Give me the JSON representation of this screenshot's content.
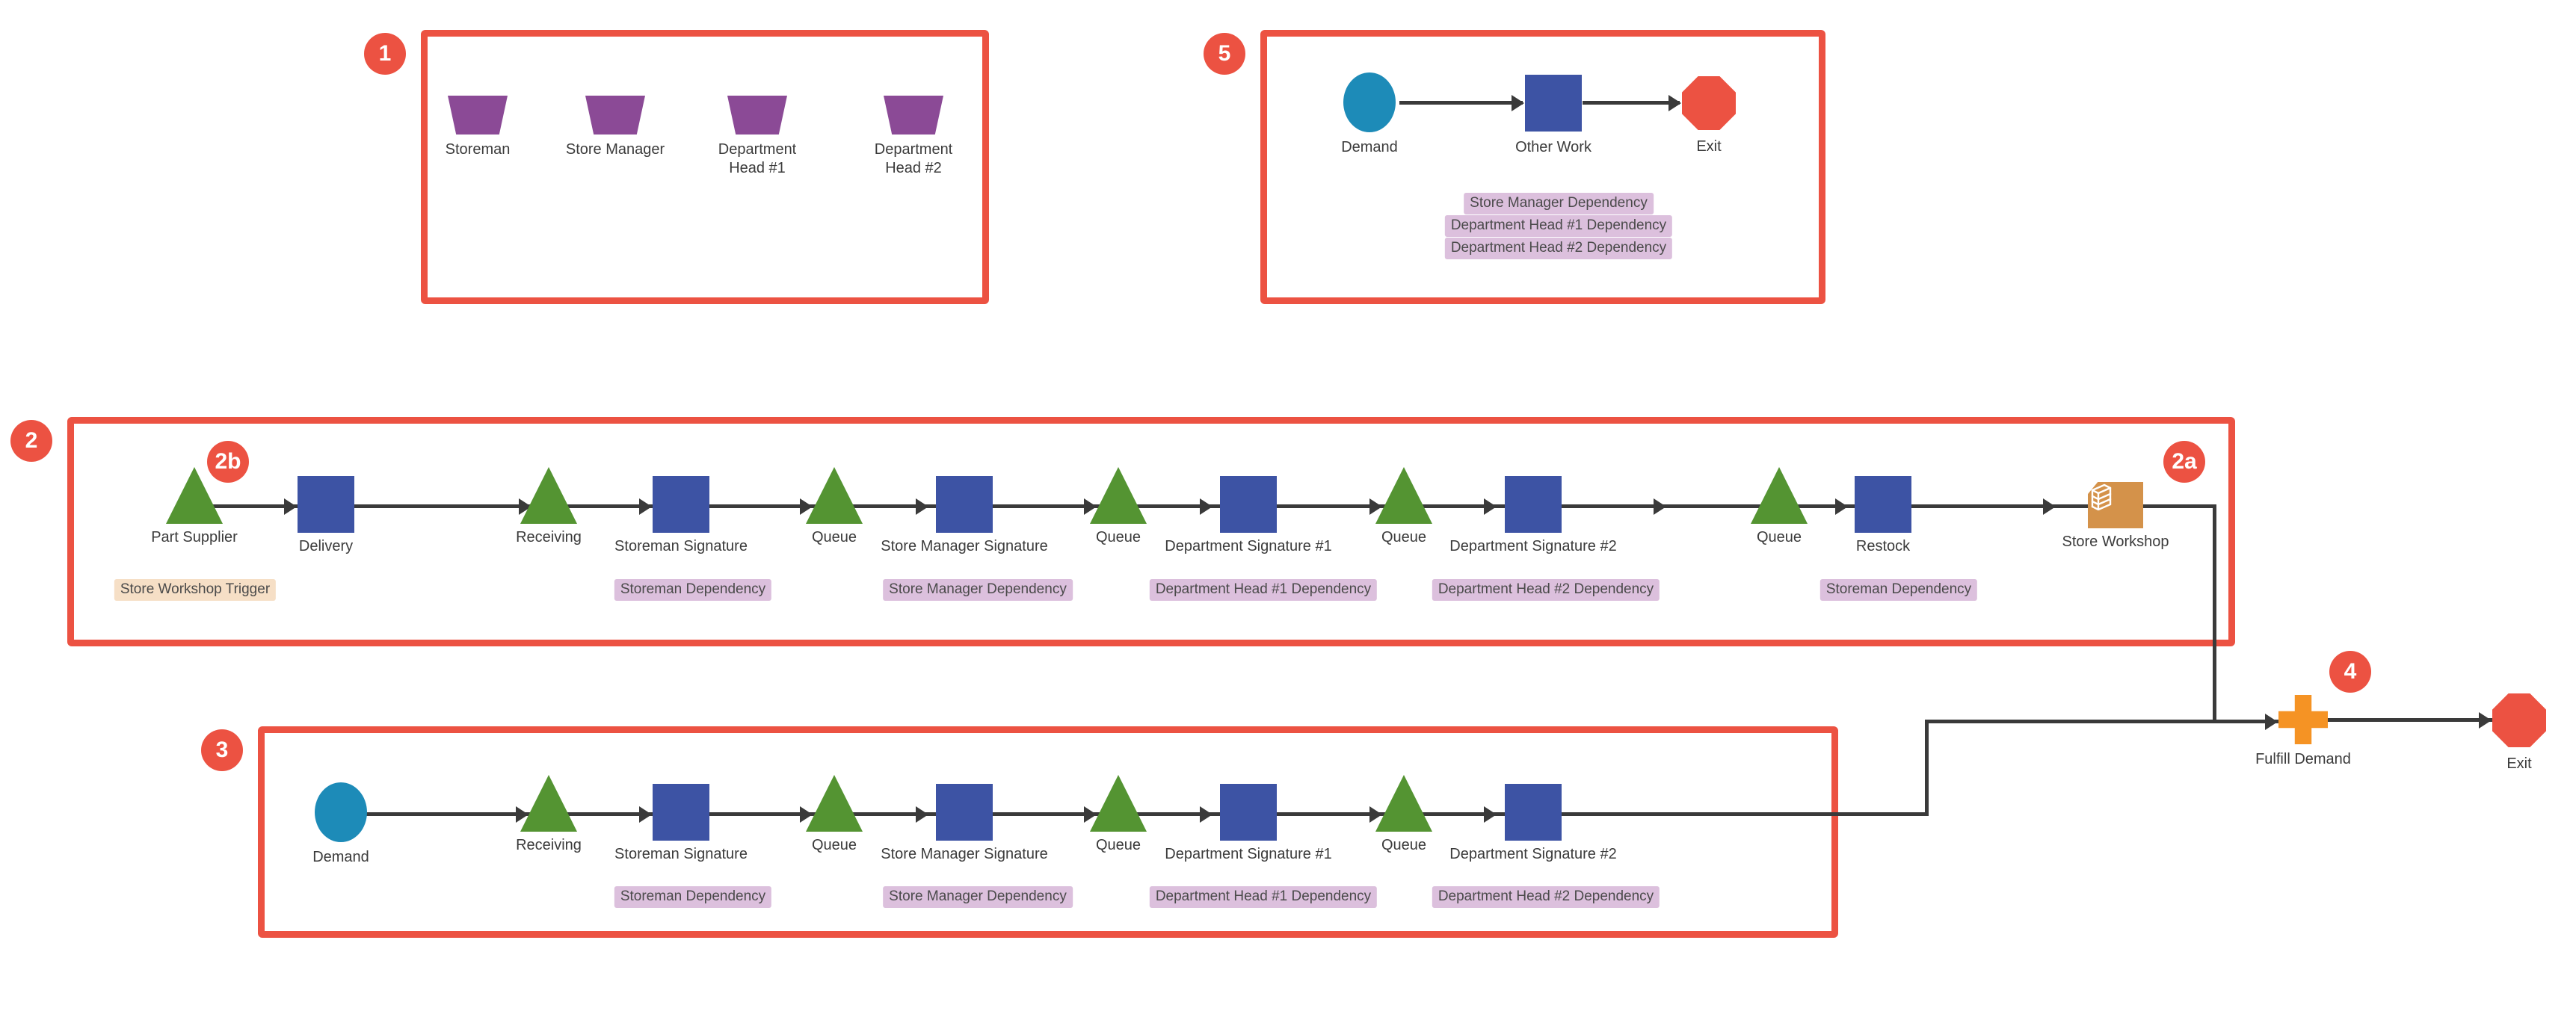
{
  "diagram": {
    "colors": {
      "frame": "#EC5242",
      "badge": "#EC5242",
      "resource": "#8B4A96",
      "source_queue": "#549432",
      "activity": "#3D53A4",
      "demand": "#1D8BB8",
      "exit": "#EC5242",
      "fulfill": "#F59324",
      "workshop": "#D4924A",
      "dependency_tag_bg": "#DCC0DD",
      "trigger_tag_bg": "#F6DFC6",
      "connector": "#3A3A3A"
    },
    "groups": [
      {
        "id": "g1",
        "badge": "1"
      },
      {
        "id": "g2",
        "badge": "2"
      },
      {
        "id": "g2a",
        "badge": "2a"
      },
      {
        "id": "g2b",
        "badge": "2b"
      },
      {
        "id": "g3",
        "badge": "3"
      },
      {
        "id": "g4",
        "badge": "4"
      },
      {
        "id": "g5",
        "badge": "5"
      }
    ],
    "panel1": {
      "badge": "1",
      "nodes": [
        {
          "label": "Storeman",
          "icon": "trapezoid-resource-icon"
        },
        {
          "label": "Store Manager",
          "icon": "trapezoid-resource-icon"
        },
        {
          "label": "Department Head #1",
          "icon": "trapezoid-resource-icon"
        },
        {
          "label": "Department Head #2",
          "icon": "trapezoid-resource-icon"
        }
      ]
    },
    "panel5": {
      "badge": "5",
      "nodes": [
        {
          "label": "Demand",
          "icon": "ellipse-demand-icon"
        },
        {
          "label": "Other Work",
          "icon": "rect-activity-icon"
        },
        {
          "label": "Exit",
          "icon": "octagon-exit-icon"
        }
      ],
      "tags": [
        "Store Manager Dependency",
        "Department Head #1 Dependency",
        "Department Head #2 Dependency"
      ]
    },
    "panel2": {
      "badge": "2",
      "badge_a": "2a",
      "badge_b": "2b",
      "nodes": [
        {
          "label": "Part Supplier",
          "icon": "triangle-source-icon",
          "tag": "Store Workshop Trigger",
          "tag_type": "trigger"
        },
        {
          "label": "Delivery",
          "icon": "rect-activity-icon",
          "tag": "",
          "tag_type": ""
        },
        {
          "label": "Receiving",
          "icon": "triangle-source-icon",
          "tag": "",
          "tag_type": ""
        },
        {
          "label": "Storeman Signature",
          "icon": "rect-activity-icon",
          "tag": "Storeman Dependency",
          "tag_type": "dependency"
        },
        {
          "label": "Queue",
          "icon": "triangle-source-icon",
          "tag": "",
          "tag_type": ""
        },
        {
          "label": "Store Manager Signature",
          "icon": "rect-activity-icon",
          "tag": "Store Manager Dependency",
          "tag_type": "dependency"
        },
        {
          "label": "Queue",
          "icon": "triangle-source-icon",
          "tag": "",
          "tag_type": ""
        },
        {
          "label": "Department Signature #1",
          "icon": "rect-activity-icon",
          "tag": "Department Head #1 Dependency",
          "tag_type": "dependency"
        },
        {
          "label": "Queue",
          "icon": "triangle-source-icon",
          "tag": "",
          "tag_type": ""
        },
        {
          "label": "Department Signature #2",
          "icon": "rect-activity-icon",
          "tag": "Department Head #2 Dependency",
          "tag_type": "dependency"
        },
        {
          "label": "Queue",
          "icon": "triangle-source-icon",
          "tag": "",
          "tag_type": ""
        },
        {
          "label": "Restock",
          "icon": "rect-activity-icon",
          "tag": "Storeman Dependency",
          "tag_type": "dependency"
        },
        {
          "label": "Store Workshop",
          "icon": "workshop-storage-icon",
          "tag": "",
          "tag_type": ""
        }
      ]
    },
    "panel3": {
      "badge": "3",
      "nodes": [
        {
          "label": "Demand",
          "icon": "ellipse-demand-icon",
          "tag": "",
          "tag_type": ""
        },
        {
          "label": "Receiving",
          "icon": "triangle-source-icon",
          "tag": "",
          "tag_type": ""
        },
        {
          "label": "Storeman Signature",
          "icon": "rect-activity-icon",
          "tag": "Storeman Dependency",
          "tag_type": "dependency"
        },
        {
          "label": "Queue",
          "icon": "triangle-source-icon",
          "tag": "",
          "tag_type": ""
        },
        {
          "label": "Store Manager Signature",
          "icon": "rect-activity-icon",
          "tag": "Store Manager Dependency",
          "tag_type": "dependency"
        },
        {
          "label": "Queue",
          "icon": "triangle-source-icon",
          "tag": "",
          "tag_type": ""
        },
        {
          "label": "Department Signature #1",
          "icon": "rect-activity-icon",
          "tag": "Department Head #1 Dependency",
          "tag_type": "dependency"
        },
        {
          "label": "Queue",
          "icon": "triangle-source-icon",
          "tag": "",
          "tag_type": ""
        },
        {
          "label": "Department Signature #2",
          "icon": "rect-activity-icon",
          "tag": "Department Head #2 Dependency",
          "tag_type": "dependency"
        }
      ]
    },
    "tail": {
      "badge": "4",
      "nodes": [
        {
          "label": "Fulfill Demand",
          "icon": "cross-fulfill-icon"
        },
        {
          "label": "Exit",
          "icon": "octagon-exit-icon"
        }
      ]
    }
  }
}
